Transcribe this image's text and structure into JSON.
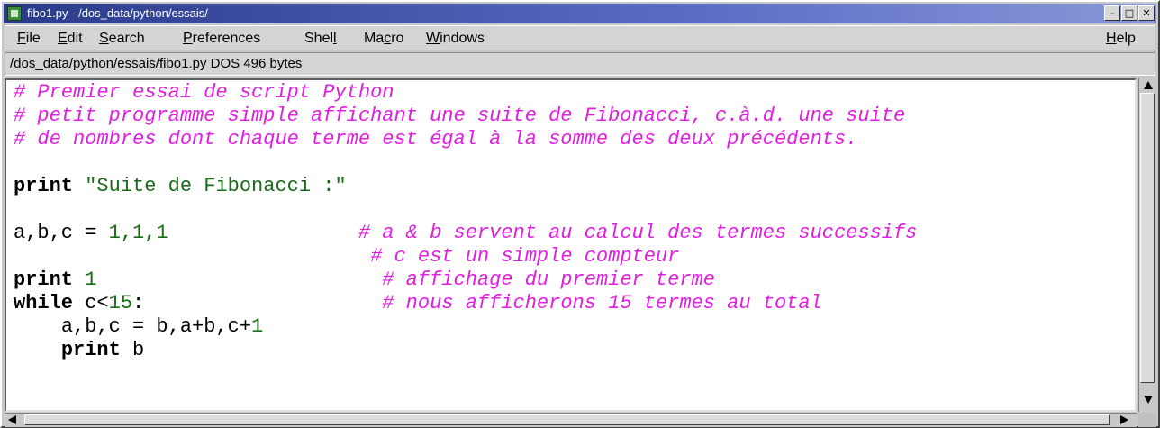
{
  "window": {
    "title": "fibo1.py - /dos_data/python/essais/",
    "buttons": {
      "minimize": "–",
      "maximize": "□",
      "close": "✕"
    }
  },
  "menubar": {
    "file": {
      "first": "F",
      "rest": "ile"
    },
    "edit": {
      "first": "E",
      "rest": "dit"
    },
    "search": {
      "first": "S",
      "rest": "earch"
    },
    "preferences": {
      "first": "P",
      "rest": "references"
    },
    "shell": {
      "pre": "Shel",
      "u": "l",
      "post": ""
    },
    "macro": {
      "pre": "Ma",
      "u": "c",
      "post": "ro"
    },
    "windows": {
      "first": "W",
      "rest": "indows"
    },
    "help": {
      "first": "H",
      "rest": "elp"
    }
  },
  "pathbar": {
    "text": "/dos_data/python/essais/fibo1.py DOS 496 bytes"
  },
  "editor": {
    "lines": [
      {
        "comment": "# Premier essai de script Python"
      },
      {
        "comment": "# petit programme simple affichant une suite de Fibonacci, c.à.d. une suite"
      },
      {
        "comment": "# de nombres dont chaque terme est égal à la somme des deux précédents."
      },
      {},
      {
        "kw": "print",
        "sp": " ",
        "str": "\"Suite de Fibonacci :\""
      },
      {},
      {
        "code1": "a,b,c = ",
        "num": "1,1,1",
        "pad": "                ",
        "comment": "# a & b servent au calcul des termes successifs"
      },
      {
        "pad": "                              ",
        "comment": "# c est un simple compteur"
      },
      {
        "kw": "print",
        "code1": " ",
        "num": "1",
        "pad": "                        ",
        "comment": "# affichage du premier terme"
      },
      {
        "kw": "while",
        "code1": " c<",
        "num": "15",
        "code2": ":",
        "pad": "                    ",
        "comment": "# nous afficherons 15 termes au total"
      },
      {
        "indent": "    ",
        "code1": "a,b,c = b,a+b,c+",
        "num": "1"
      },
      {
        "indent": "    ",
        "kw": "print",
        "code1": " b"
      }
    ]
  },
  "colors": {
    "comment": "#e020e0",
    "string": "#1a6a1a",
    "titlebar_start": "#2a3a8a"
  },
  "icons": {
    "app": "python-file-icon",
    "scroll_up": "triangle-up-icon",
    "scroll_down": "triangle-down-icon",
    "scroll_left": "triangle-left-icon",
    "scroll_right": "triangle-right-icon"
  }
}
